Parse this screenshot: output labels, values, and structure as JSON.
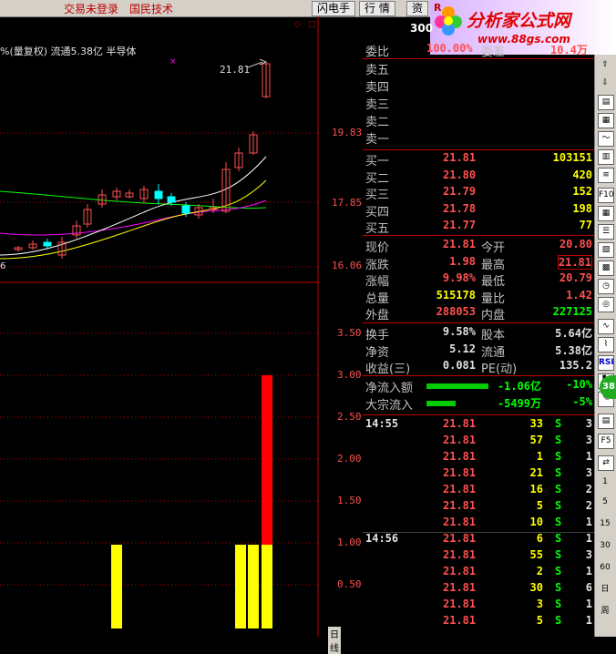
{
  "topbar": {
    "login_status": "交易未登录",
    "broker": "国民技术",
    "btn_flash": "闪电手",
    "btn_quote": "行 情",
    "btn_info": "资",
    "symbol_badge": "R",
    "symbol_code": "300"
  },
  "watermark": {
    "brand": "分析家公式网",
    "url": "www.88gs.com"
  },
  "chart": {
    "info_line": "%(量复权) 流通5.38亿 半导体",
    "high_label": "21.81",
    "low_label": "6",
    "price_axis": [
      "19.83",
      "17.85",
      "16.06"
    ],
    "indicator_axis": [
      "3.50",
      "3.00",
      "2.50",
      "2.00",
      "1.50",
      "1.00",
      "0.50"
    ],
    "bottom_tab": "日线",
    "colors": {
      "up": "#ff5050",
      "down": "#00ffff",
      "ma5": "#ffffff",
      "ma10": "#ffff00",
      "ma20": "#ff00ff",
      "ma60": "#00ff00"
    }
  },
  "quote": {
    "ratio_label": "委比",
    "ratio_value": "100.00%",
    "diff_label": "委差",
    "diff_value": "10.4万",
    "ask_levels": [
      {
        "label": "卖五"
      },
      {
        "label": "卖四"
      },
      {
        "label": "卖三"
      },
      {
        "label": "卖二"
      },
      {
        "label": "卖一"
      }
    ],
    "bid_levels": [
      {
        "label": "买一",
        "price": "21.81",
        "volume": "103151"
      },
      {
        "label": "买二",
        "price": "21.80",
        "volume": "420"
      },
      {
        "label": "买三",
        "price": "21.79",
        "volume": "152"
      },
      {
        "label": "买四",
        "price": "21.78",
        "volume": "198"
      },
      {
        "label": "买五",
        "price": "21.77",
        "volume": "77"
      }
    ],
    "stats": [
      {
        "l1": "现价",
        "v1": "21.81",
        "l2": "今开",
        "v2": "20.80"
      },
      {
        "l1": "涨跌",
        "v1": "1.98",
        "l2": "最高",
        "v2": "21.81"
      },
      {
        "l1": "涨幅",
        "v1": "9.98%",
        "l2": "最低",
        "v2": "20.79"
      },
      {
        "l1": "总量",
        "v1": "515178",
        "l2": "量比",
        "v2": "1.42"
      },
      {
        "l1": "外盘",
        "v1": "288053",
        "l2": "内盘",
        "v2": "227125"
      }
    ],
    "fundamentals": [
      {
        "l1": "换手",
        "v1": "9.58%",
        "l2": "股本",
        "v2": "5.64亿"
      },
      {
        "l1": "净资",
        "v1": "5.12",
        "l2": "流通",
        "v2": "5.38亿"
      },
      {
        "l1": "收益(三)",
        "v1": "0.081",
        "l2": "PE(动)",
        "v2": "135.2"
      }
    ],
    "flows": [
      {
        "label": "净流入额",
        "value": "-1.06亿",
        "pct": "-10%",
        "bar": 0.95
      },
      {
        "label": "大宗流入",
        "value": "-5499万",
        "pct": "-5%",
        "bar": 0.45
      }
    ]
  },
  "ticks": [
    {
      "time": "14:55",
      "price": "21.81",
      "vol": "33",
      "side": "S",
      "n": "3"
    },
    {
      "time": "",
      "price": "21.81",
      "vol": "57",
      "side": "S",
      "n": "3"
    },
    {
      "time": "",
      "price": "21.81",
      "vol": "1",
      "side": "S",
      "n": "1"
    },
    {
      "time": "",
      "price": "21.81",
      "vol": "21",
      "side": "S",
      "n": "3"
    },
    {
      "time": "",
      "price": "21.81",
      "vol": "16",
      "side": "S",
      "n": "2"
    },
    {
      "time": "",
      "price": "21.81",
      "vol": "5",
      "side": "S",
      "n": "2"
    },
    {
      "time": "",
      "price": "21.81",
      "vol": "10",
      "side": "S",
      "n": "1"
    },
    {
      "time": "14:56",
      "price": "21.81",
      "vol": "6",
      "side": "S",
      "n": "1"
    },
    {
      "time": "",
      "price": "21.81",
      "vol": "55",
      "side": "S",
      "n": "3"
    },
    {
      "time": "",
      "price": "21.81",
      "vol": "2",
      "side": "S",
      "n": "1"
    },
    {
      "time": "",
      "price": "21.81",
      "vol": "30",
      "side": "S",
      "n": "6"
    },
    {
      "time": "",
      "price": "21.81",
      "vol": "3",
      "side": "S",
      "n": "1"
    },
    {
      "time": "",
      "price": "21.81",
      "vol": "5",
      "side": "S",
      "n": "1"
    }
  ],
  "toolbar": {
    "items": [
      "F10",
      "F5",
      "1",
      "5",
      "15",
      "30",
      "60",
      "日",
      "周",
      "RSI",
      "38"
    ]
  }
}
